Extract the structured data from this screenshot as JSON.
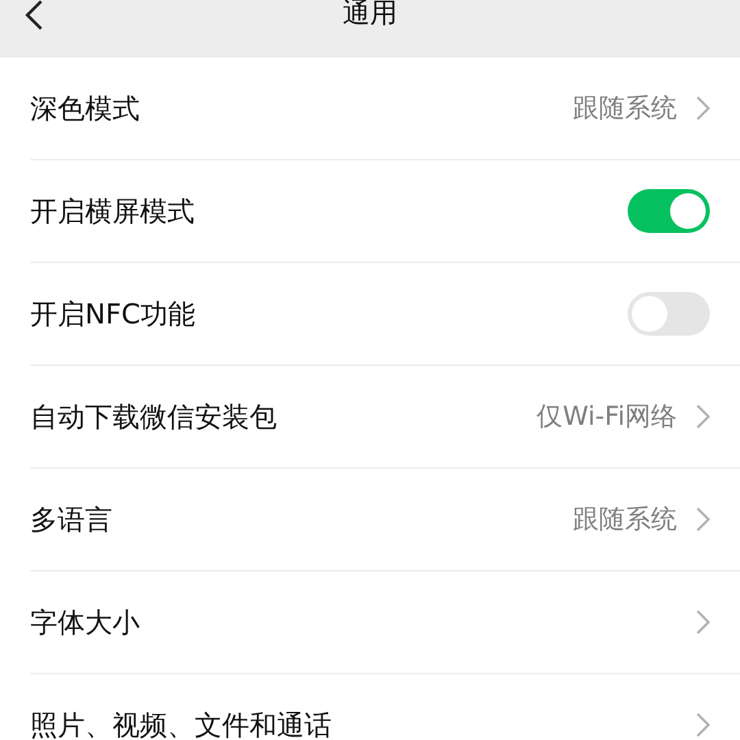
{
  "header": {
    "title": "通用"
  },
  "settings": [
    {
      "kind": "value",
      "label": "深色模式",
      "value": "跟随系统"
    },
    {
      "kind": "toggle",
      "label": "开启横屏模式",
      "on": true
    },
    {
      "kind": "toggle",
      "label": "开启NFC功能",
      "on": false
    },
    {
      "kind": "value",
      "label": "自动下载微信安装包",
      "value": "仅Wi-Fi网络"
    },
    {
      "kind": "value",
      "label": "多语言",
      "value": "跟随系统"
    },
    {
      "kind": "link",
      "label": "字体大小"
    },
    {
      "kind": "link",
      "label": "照片、视频、文件和通话"
    }
  ]
}
